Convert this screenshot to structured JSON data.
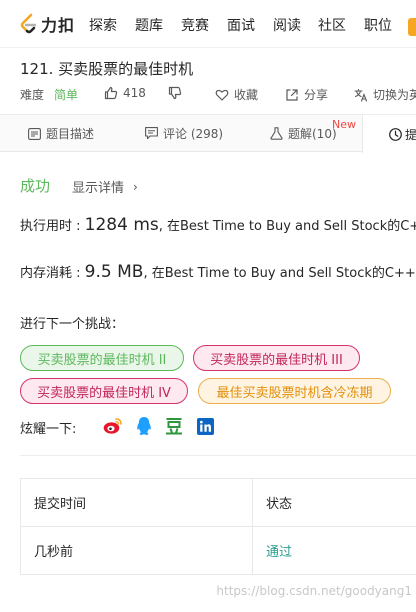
{
  "nav": {
    "logo_text": "力扣",
    "items": [
      "探索",
      "题库",
      "竞赛",
      "面试",
      "阅读",
      "社区",
      "职位"
    ]
  },
  "problem": {
    "title": "121. 买卖股票的最佳时机",
    "difficulty_label": "难度",
    "difficulty": "简单",
    "likes": "418",
    "favorite": "收藏",
    "share": "分享",
    "switch_lang": "切换为英"
  },
  "tabs": {
    "description": "题目描述",
    "comments": "评论 (298)",
    "solutions": "题解(10)",
    "new_badge": "New",
    "submissions": "提"
  },
  "result": {
    "status": "成功",
    "show_detail": "显示详情",
    "runtime_label": "执行用时 : ",
    "runtime_value": "1284 ms",
    "runtime_desc": ", 在Best Time to Buy and Sell Stock的C++",
    "memory_label": "内存消耗 : ",
    "memory_value": "9.5 MB",
    "memory_desc": ", 在Best Time to Buy and Sell Stock的C++提"
  },
  "next": {
    "label": "进行下一个挑战：",
    "challenges": [
      "买卖股票的最佳时机 II",
      "买卖股票的最佳时机 III",
      "买卖股票的最佳时机 IV",
      "最佳买卖股票时机含冷冻期"
    ]
  },
  "share_section": {
    "label": "炫耀一下:"
  },
  "submission_table": {
    "headers": [
      "提交时间",
      "状态"
    ],
    "rows": [
      {
        "time": "几秒前",
        "status": "通过"
      }
    ]
  },
  "watermark": "https://blog.csdn.net/goodyang1",
  "colors": {
    "success": "#5cb85c",
    "brand": "#f5a623",
    "weibo": "#e6162d",
    "qq": "#1e9fff",
    "douban": "#2e963d",
    "linkedin": "#0a66c2"
  }
}
